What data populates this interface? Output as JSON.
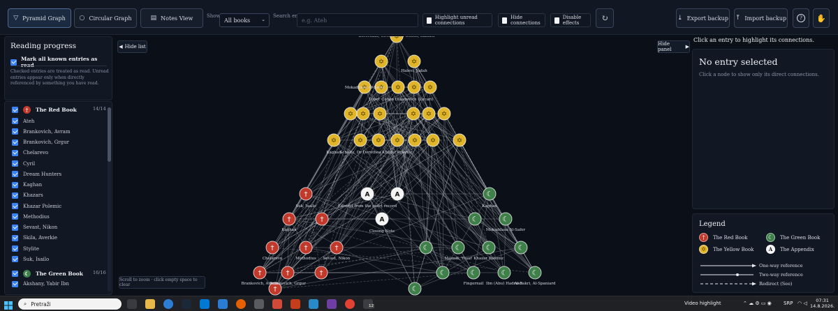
{
  "toolbar": {
    "pyramid_label": "Pyramid Graph",
    "circular_label": "Circular Graph",
    "notes_label": "Notes View",
    "show_label": "Show",
    "show_value": "All books",
    "search_label": "Search entry",
    "search_placeholder": "e.g. Ateh",
    "highlight_unread_label": "Highlight unread connections",
    "hide_connections_label": "Hide connections",
    "disable_effects_label": "Disable effects",
    "export_label": "Export backup",
    "import_label": "Import backup",
    "help_label": "?"
  },
  "left_panel": {
    "title": "Reading progress",
    "mark_all_label": "Mark all known entries as read",
    "note": "Checked entries are treated as read. Unread entries appear only when directly referenced by something you have read.",
    "red_book": {
      "name": "The Red Book",
      "count": "14/14",
      "entries": [
        "Ateh",
        "Brankovich, Avram",
        "Brankovich, Grgur",
        "Chelarevo",
        "Cyril",
        "Dream Hunters",
        "Kaghan",
        "Khazars",
        "Khazar Polemic",
        "Methodius",
        "Sevast, Nikon",
        "Skila, Averkie",
        "Stylite",
        "Suk, Isailo"
      ]
    },
    "green_book": {
      "name": "The Green Book",
      "count": "16/16",
      "entries": [
        "Akshany, Yabir Ibn"
      ]
    }
  },
  "graph": {
    "hide_list_label": "Hide list",
    "hide_panel_label": "Hide panel",
    "scroll_hint": "Scroll to zoom · click empty space to clear",
    "node_labels": {
      "y1": "Berechiah, Covenant of Cohen, Samuel",
      "y2": "Halevi, Judah",
      "y3": "Mokaddasa Al-Safer",
      "y4": "Lober Cohen",
      "y5": "Lukarevich (Lucari)",
      "y6": "Kaghan",
      "y7": "Schultz, Dr Dorothea",
      "y8": "Khazar Polemic",
      "r1": "Suk, Isailo",
      "r2": "Kaghan",
      "r3": "Chelarevo",
      "r4": "Methodius",
      "r5": "Sevast, Nikon",
      "a1": "Excerpt from the court record",
      "a2": "Closing Note",
      "g1": "Kaghan",
      "g2": "Mokaddasa Al-Safer",
      "g3": "Masudi, Yusuf",
      "g4": "Khazar Polemic",
      "g5": "Ibn (Abu) Hadrash",
      "g6": "Fingernail",
      "g7": "Al-Bakri, Al-Spaniard",
      "bl1": "Brankovich, Avram",
      "bl2": "Brankovich, Grgur"
    }
  },
  "right_panel": {
    "header": "Click an entry to highlight its connections.",
    "title": "No entry selected",
    "subtitle": "Click a node to show only its direct connections."
  },
  "legend": {
    "title": "Legend",
    "red": "The Red Book",
    "green": "The Green Book",
    "yellow": "The Yellow Book",
    "appendix": "The Appendix",
    "one_way": "One-way reference",
    "two_way": "Two-way reference",
    "redirect": "Redirect (See)"
  },
  "colors": {
    "red": "#c0392b",
    "green": "#3f7f4a",
    "yellow": "#e0b52a",
    "appendix": "#f4f4f4",
    "accent": "#3b82f6"
  },
  "icons": {
    "red": "cross-icon",
    "green": "crescent-icon",
    "yellow": "star-of-david-icon",
    "appendix": "letter-a-icon"
  },
  "taskbar": {
    "search_placeholder": "Pretraži",
    "video_highlight": "Video highlight",
    "lang": "SRP",
    "time": "07:31",
    "date": "14.8.2026.",
    "badge": "12"
  }
}
